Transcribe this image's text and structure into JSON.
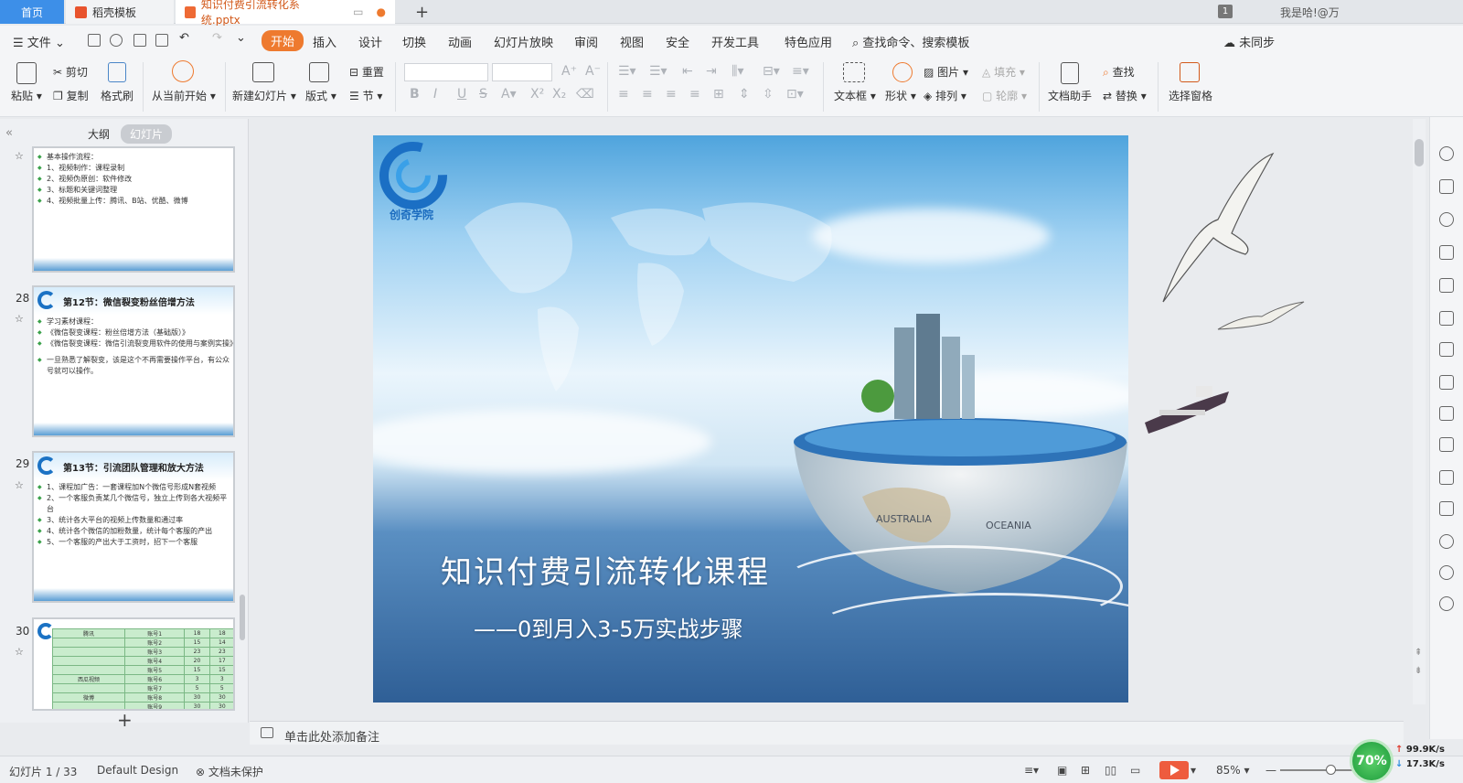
{
  "tabs": {
    "home": "首页",
    "template": "稻壳模板",
    "document": "知识付费引流转化系统.pptx",
    "badge_num": "1",
    "user": "我是哈!@万"
  },
  "menu": {
    "file": "文件",
    "start": "开始",
    "insert": "插入",
    "design": "设计",
    "transition": "切换",
    "animation": "动画",
    "slideshow": "幻灯片放映",
    "review": "审阅",
    "view": "视图",
    "security": "安全",
    "devtools": "开发工具",
    "special": "特色应用",
    "search": "查找命令、搜索模板",
    "sync": "未同步"
  },
  "ribbon": {
    "paste": "粘贴",
    "cut": "剪切",
    "copy": "复制",
    "format_painter": "格式刷",
    "from_current": "从当前开始",
    "new_slide": "新建幻灯片",
    "layout": "版式",
    "reset": "重置",
    "section": "节",
    "textbox": "文本框",
    "shape": "形状",
    "picture": "图片",
    "fill": "填充",
    "arrange": "排列",
    "outline": "轮廓",
    "doc_assistant": "文档助手",
    "find": "查找",
    "replace": "替换",
    "select_pane": "选择窗格"
  },
  "left_panel": {
    "tab_outline": "大纲",
    "tab_slides": "幻灯片",
    "slide27": {
      "lines": [
        "基本操作流程：",
        "1、视频制作：课程录制",
        "2、视频伪原创：软件修改",
        "3、标题和关键词整理",
        "4、视频批量上传：腾讯、B站、优酷、微博"
      ]
    },
    "slide28": {
      "number": "28",
      "title": "第12节：微信裂变粉丝倍增方法",
      "lines": [
        "学习素材课程：",
        "《微信裂变课程：粉丝倍增方法（基础版）》",
        "《微信裂变课程：微信引流裂变用软件的使用与案例实操》",
        "一旦熟悉了解裂变，该是这个不再需要操作平台，有公众号就可以操作。"
      ]
    },
    "slide29": {
      "number": "29",
      "title": "第13节：引流团队管理和放大方法",
      "lines": [
        "1、课程加广告：一套课程加N个微信号形成N套视频",
        "2、一个客服负责某几个微信号，独立上传到各大视频平台",
        "3、统计各大平台的视频上传数量和通过率",
        "4、统计各个微信的加粉数量，统计每个客服的产出",
        "5、一个客服的产出大于工资时，招下一个客服"
      ]
    },
    "slide30": {
      "number": "30",
      "table": [
        [
          "腾讯",
          "账号1",
          "18",
          "18"
        ],
        [
          "",
          "账号2",
          "15",
          "14"
        ],
        [
          "",
          "账号3",
          "23",
          "23"
        ],
        [
          "",
          "账号4",
          "20",
          "17"
        ],
        [
          "",
          "账号5",
          "15",
          "15"
        ],
        [
          "西瓜视频",
          "账号6",
          "3",
          "3"
        ],
        [
          "",
          "账号7",
          "5",
          "5"
        ],
        [
          "微博",
          "账号8",
          "30",
          "30"
        ],
        [
          "",
          "账号9",
          "30",
          "30"
        ],
        [
          "优酷",
          "账号10",
          "20",
          "7"
        ],
        [
          "",
          "账号11",
          "20",
          "13"
        ],
        [
          "",
          "账号12",
          "20",
          "20"
        ]
      ]
    }
  },
  "slide": {
    "logo_text": "创奇学院",
    "title": "知识付费引流转化课程",
    "subtitle": "——0到月入3-5万实战步骤",
    "globe_labels": [
      "AUSTRALIA",
      "OCEANIA"
    ]
  },
  "notes": {
    "placeholder": "单击此处添加备注"
  },
  "status": {
    "slide_info": "幻灯片 1 / 33",
    "design": "Default Design",
    "protect": "文档未保护",
    "zoom": "85%",
    "net_percent": "70%",
    "up_speed": "99.9K/s",
    "down_speed": "17.3K/s"
  }
}
